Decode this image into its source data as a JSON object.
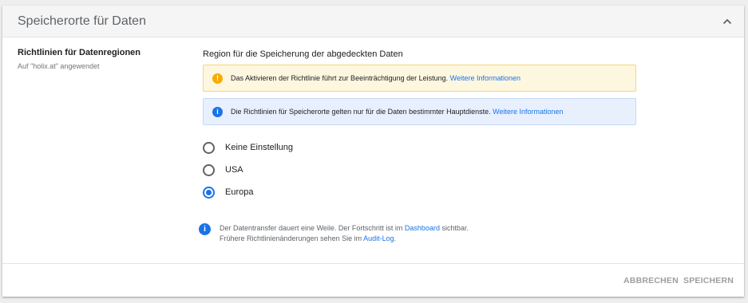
{
  "card": {
    "title": "Speicherorte für Daten"
  },
  "setting": {
    "title": "Richtlinien für Datenregionen",
    "subtitle": "Auf \"holix.at\" angewendet"
  },
  "region": {
    "label": "Region für die Speicherung der abgedeckten Daten"
  },
  "banners": {
    "warning": {
      "text": "Das Aktivieren der Richtlinie führt zur Beeinträchtigung der Leistung. ",
      "link": "Weitere Informationen",
      "icon_glyph": "!"
    },
    "info": {
      "text": "Die Richtlinien für Speicherorte gelten nur für die Daten bestimmter Hauptdienste. ",
      "link": "Weitere Informationen",
      "icon_glyph": "i"
    }
  },
  "options": [
    {
      "label": "Keine Einstellung",
      "checked": false
    },
    {
      "label": "USA",
      "checked": false
    },
    {
      "label": "Europa",
      "checked": true
    }
  ],
  "footnote": {
    "icon_glyph": "i",
    "line1_pre": "Der Datentransfer dauert eine Weile. Der Fortschritt ist im ",
    "line1_link": "Dashboard",
    "line1_post": " sichtbar.",
    "line2_pre": "Frühere Richtlinienänderungen sehen Sie im ",
    "line2_link": "Audit-Log",
    "line2_post": "."
  },
  "actions": {
    "cancel": "ABBRECHEN",
    "save": "SPEICHERN"
  }
}
